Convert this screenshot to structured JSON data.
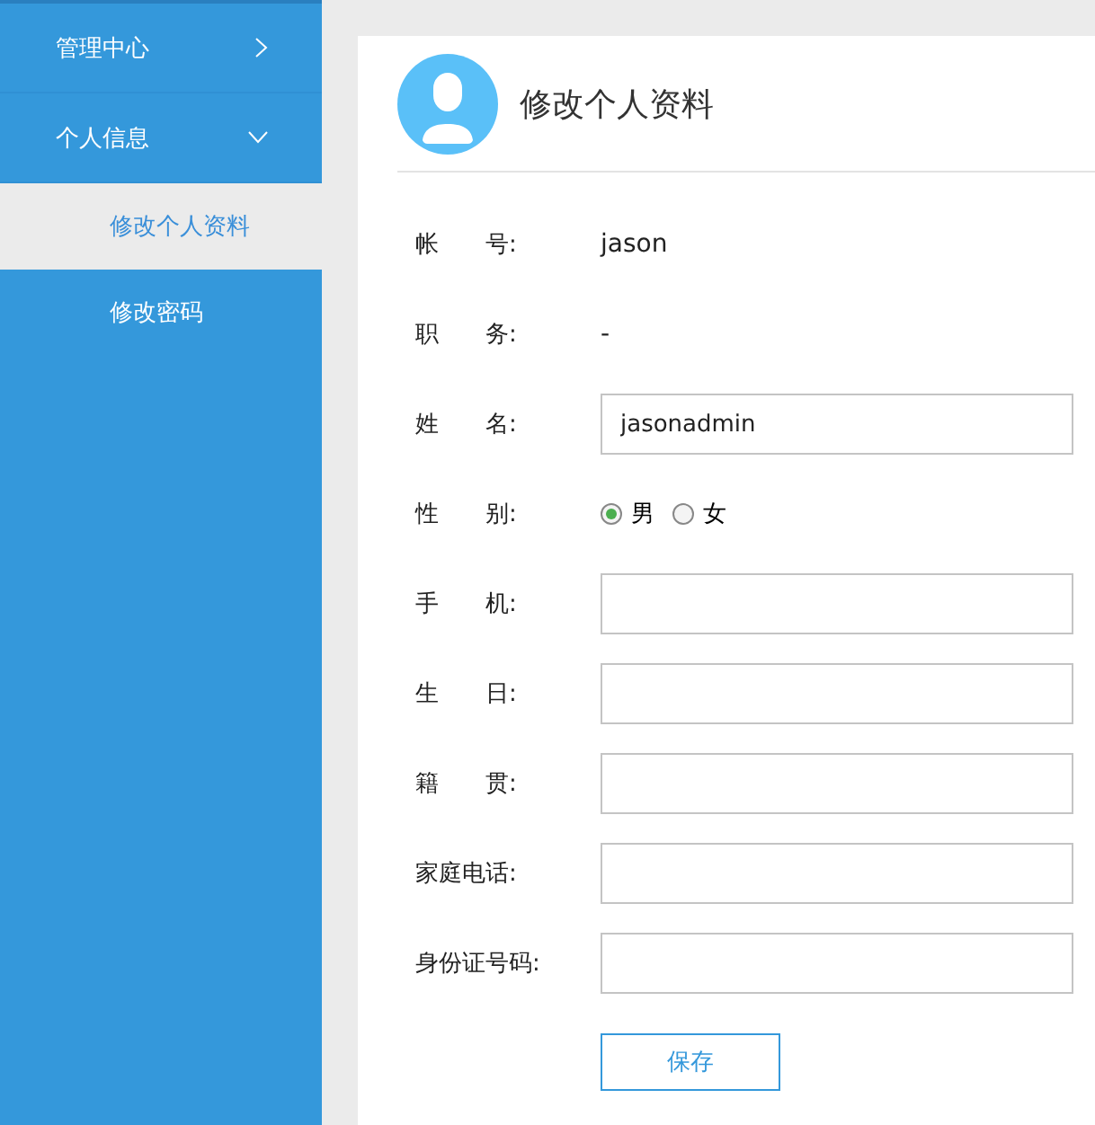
{
  "sidebar": {
    "items": [
      {
        "label": "管理中心",
        "expanded": false
      },
      {
        "label": "个人信息",
        "expanded": true,
        "children": [
          {
            "label": "修改个人资料",
            "selected": true
          },
          {
            "label": "修改密码",
            "selected": false
          }
        ]
      }
    ]
  },
  "card": {
    "title": "修改个人资料",
    "fields": [
      {
        "kind": "text",
        "label": "帐　　号:",
        "value": "jason"
      },
      {
        "kind": "text",
        "label": "职　　务:",
        "value": "-"
      },
      {
        "kind": "input",
        "label": "姓　　名:",
        "value": "jasonadmin"
      },
      {
        "kind": "radio",
        "label": "性　　别:",
        "options": [
          {
            "label": "男",
            "selected": true
          },
          {
            "label": "女",
            "selected": false
          }
        ]
      },
      {
        "kind": "input",
        "label": "手　　机:"
      },
      {
        "kind": "input",
        "label": "生　　日:"
      },
      {
        "kind": "input",
        "label": "籍　　贯:"
      },
      {
        "kind": "input",
        "label": "家庭电话:"
      },
      {
        "kind": "input",
        "label": "身份证号码:"
      }
    ],
    "save_button": "保存"
  }
}
